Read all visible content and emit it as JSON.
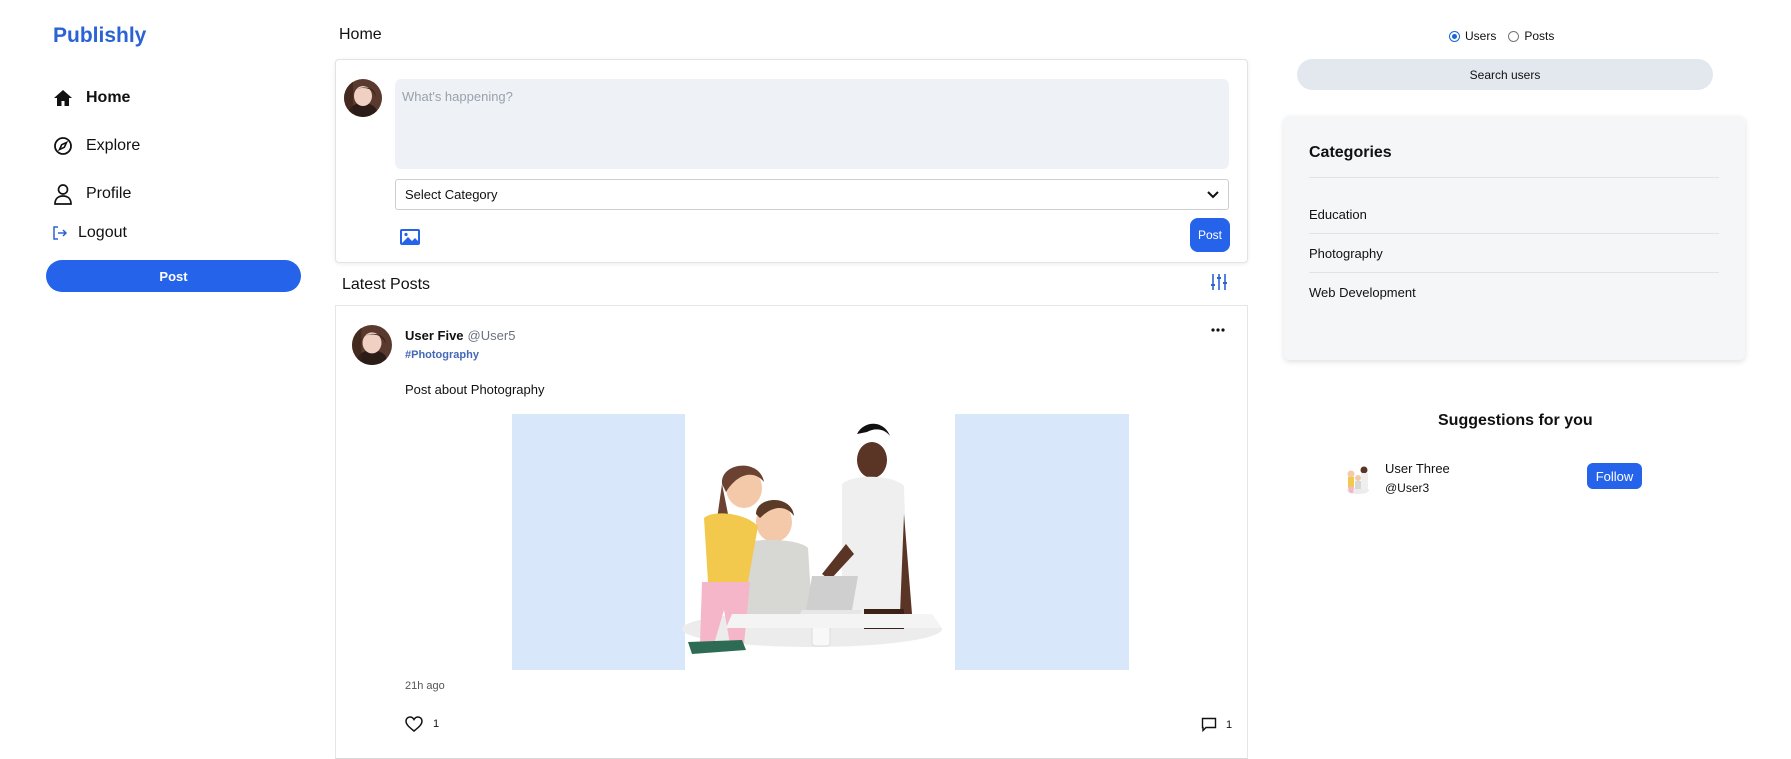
{
  "brand": "Publishly",
  "sidebar": {
    "items": [
      {
        "label": "Home",
        "icon": "home-icon"
      },
      {
        "label": "Explore",
        "icon": "compass-icon"
      },
      {
        "label": "Profile",
        "icon": "user-icon"
      },
      {
        "label": "Logout",
        "icon": "logout-icon"
      }
    ],
    "post_label": "Post"
  },
  "main": {
    "title": "Home",
    "composer": {
      "placeholder": "What's happening?",
      "category_select": "Select Category",
      "post_label": "Post"
    },
    "feed_title": "Latest Posts",
    "posts": [
      {
        "name": "User Five",
        "handle": "@User5",
        "tag": "#Photography",
        "text": "Post about Photography",
        "time": "21h ago",
        "likes": "1",
        "comments": "1"
      }
    ]
  },
  "right": {
    "search_mode": {
      "options": [
        "Users",
        "Posts"
      ],
      "selected": "Users"
    },
    "search_label": "Search users",
    "categories": {
      "title": "Categories",
      "items": [
        "Education",
        "Photography",
        "Web Development"
      ]
    },
    "suggestions": {
      "title": "Suggestions for you",
      "users": [
        {
          "name": "User Three",
          "handle": "@User3",
          "action": "Follow"
        }
      ]
    }
  },
  "colors": {
    "accent": "#2563eb",
    "brand": "#2a63d4",
    "input_bg": "#eef2f7",
    "media_bg": "#d9e7fb"
  }
}
